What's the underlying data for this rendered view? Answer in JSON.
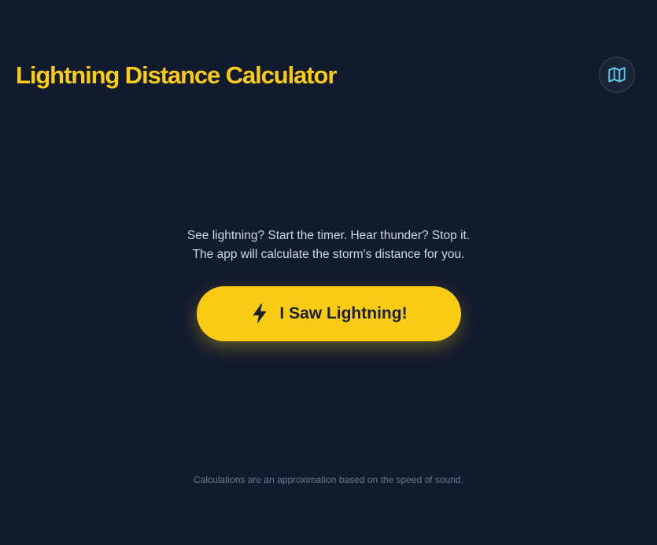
{
  "header": {
    "title": "Lightning Distance Calculator",
    "map_icon": "map-icon"
  },
  "main": {
    "instruction_line_1": "See lightning? Start the timer. Hear thunder? Stop it.",
    "instruction_line_2": "The app will calculate the storm's distance for you.",
    "button_icon": "lightning-bolt-icon",
    "button_label": "I Saw Lightning!"
  },
  "footer": {
    "note": "Calculations are an approximation based on the speed of sound."
  },
  "colors": {
    "background": "#121a2e",
    "accent": "#facc15",
    "map_icon": "#5ec8e5",
    "button_text": "#1a1f2b"
  }
}
